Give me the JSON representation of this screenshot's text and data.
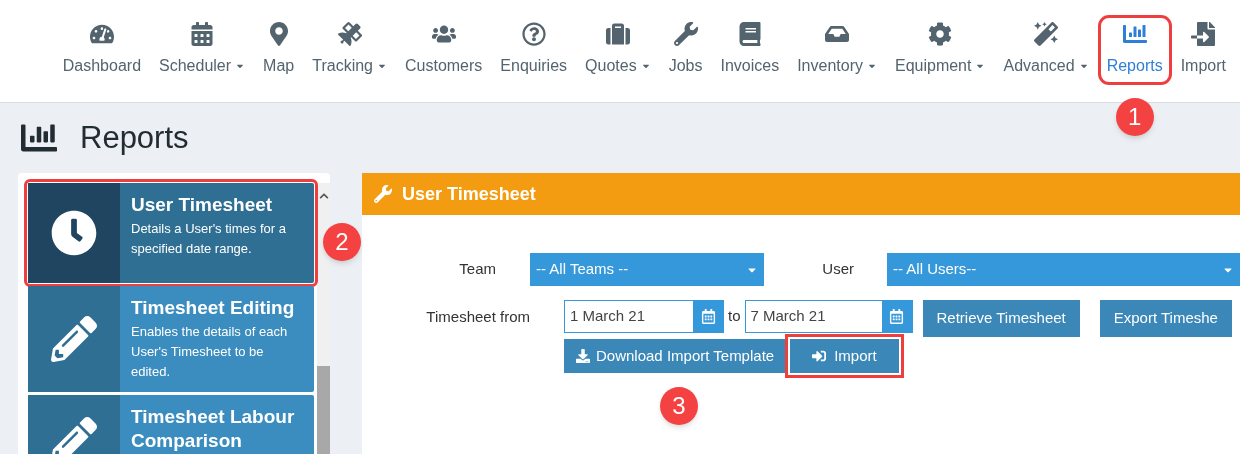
{
  "nav": [
    {
      "label": "Dashboard",
      "dropdown": false,
      "selected": false
    },
    {
      "label": "Scheduler",
      "dropdown": true,
      "selected": false
    },
    {
      "label": "Map",
      "dropdown": false,
      "selected": false
    },
    {
      "label": "Tracking",
      "dropdown": true,
      "selected": false
    },
    {
      "label": "Customers",
      "dropdown": false,
      "selected": false
    },
    {
      "label": "Enquiries",
      "dropdown": false,
      "selected": false
    },
    {
      "label": "Quotes",
      "dropdown": true,
      "selected": false
    },
    {
      "label": "Jobs",
      "dropdown": false,
      "selected": false
    },
    {
      "label": "Invoices",
      "dropdown": false,
      "selected": false
    },
    {
      "label": "Inventory",
      "dropdown": true,
      "selected": false
    },
    {
      "label": "Equipment",
      "dropdown": true,
      "selected": false
    },
    {
      "label": "Advanced",
      "dropdown": true,
      "selected": false
    },
    {
      "label": "Reports",
      "dropdown": false,
      "selected": true,
      "callout": "1"
    },
    {
      "label": "Import",
      "dropdown": false,
      "selected": false
    }
  ],
  "page_title": "Reports",
  "report_list": [
    {
      "title": "User Timesheet",
      "description": "Details a User's times for a specified date range.",
      "selected": true,
      "callout": "2"
    },
    {
      "title": "Timesheet Editing",
      "description": "Enables the details of each User's Timesheet to be edited.",
      "selected": false
    },
    {
      "title": "Timesheet Labour Comparison",
      "selected": false
    }
  ],
  "panel": {
    "title": "User Timesheet",
    "team_label": "Team",
    "team_value": "-- All Teams --",
    "user_label": "User",
    "user_value": "-- All Users--",
    "from_label": "Timesheet from",
    "from_value": "1 March 21",
    "to_label": "to",
    "to_value": "7 March 21",
    "buttons": [
      {
        "label": "Retrieve Timesheet"
      },
      {
        "label": "Export Timeshe"
      }
    ],
    "download_button": {
      "label": "Download Import Template"
    },
    "import_button": {
      "label": "Import",
      "callout": "3"
    }
  }
}
